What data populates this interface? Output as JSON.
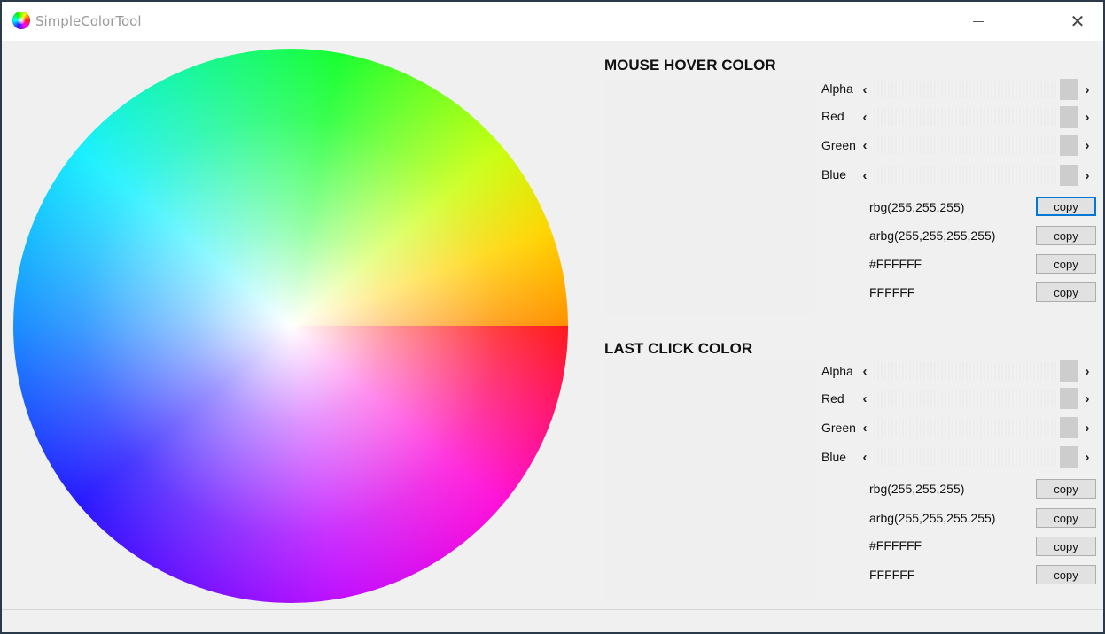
{
  "window": {
    "title": "SimpleColorTool",
    "app_icon": "color-wheel-icon",
    "minimize_icon": "minimize-icon",
    "close_icon": "close-icon",
    "minimize_glyph": "—",
    "close_glyph": "✕"
  },
  "color_wheel": {
    "center_color": "#FFFFFF",
    "hue_colors": [
      "#ff1a1a",
      "#ff10d8",
      "#2818ff",
      "#18f0ff",
      "#18ff30",
      "#ffd400"
    ]
  },
  "hover": {
    "title": "MOUSE HOVER COLOR",
    "channels": [
      {
        "label": "Alpha",
        "left": "‹",
        "right": "›"
      },
      {
        "label": "Red",
        "left": "‹",
        "right": "›"
      },
      {
        "label": "Green",
        "left": "‹",
        "right": "›"
      },
      {
        "label": "Blue",
        "left": "‹",
        "right": "›"
      }
    ],
    "values": [
      {
        "text": "rbg(255,255,255)",
        "button": "copy"
      },
      {
        "text": "arbg(255,255,255,255)",
        "button": "copy"
      },
      {
        "text": "#FFFFFF",
        "button": "copy"
      },
      {
        "text": "FFFFFF",
        "button": "copy"
      }
    ]
  },
  "click": {
    "title": "LAST CLICK COLOR",
    "channels": [
      {
        "label": "Alpha",
        "left": "‹",
        "right": "›"
      },
      {
        "label": "Red",
        "left": "‹",
        "right": "›"
      },
      {
        "label": "Green",
        "left": "‹",
        "right": "›"
      },
      {
        "label": "Blue",
        "left": "‹",
        "right": "›"
      }
    ],
    "values": [
      {
        "text": "rbg(255,255,255)",
        "button": "copy"
      },
      {
        "text": "arbg(255,255,255,255)",
        "button": "copy"
      },
      {
        "text": "#FFFFFF",
        "button": "copy"
      },
      {
        "text": "FFFFFF",
        "button": "copy"
      }
    ]
  },
  "colors": {
    "focus_accent": "#0078d7",
    "button_face": "#e1e1e1"
  }
}
